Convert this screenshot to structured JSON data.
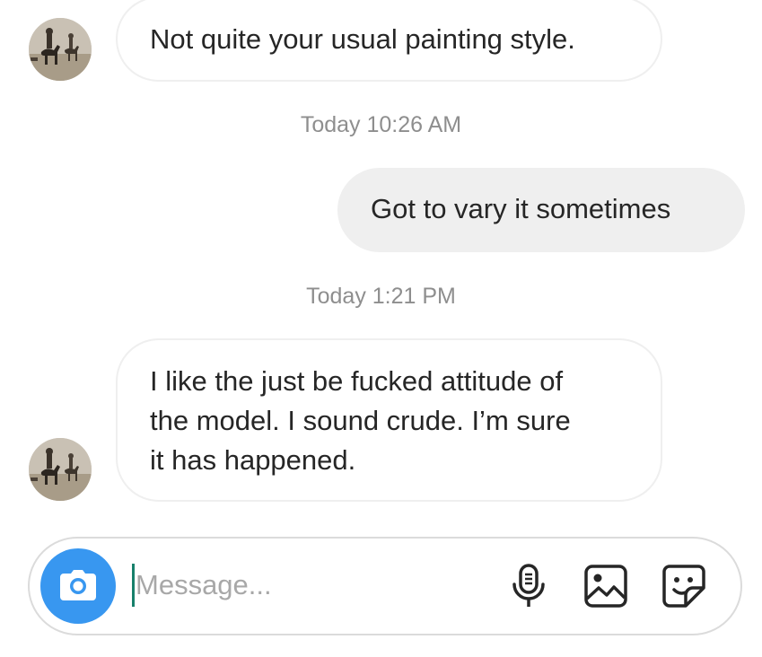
{
  "conversation": {
    "messages": [
      {
        "direction": "incoming",
        "text": "Not quite your usual painting style."
      },
      {
        "direction": "outgoing",
        "text": "Got to vary it sometimes"
      },
      {
        "direction": "incoming",
        "lines": [
          "I like the just be fucked attitude of",
          "the model. I sound crude. I’m sure",
          "it has happened."
        ]
      }
    ],
    "timestamps": [
      "Today 10:26 AM",
      "Today 1:21 PM"
    ]
  },
  "composer": {
    "placeholder": "Message...",
    "value": "",
    "icons": [
      "camera-icon",
      "microphone-icon",
      "gallery-icon",
      "sticker-icon"
    ]
  },
  "colors": {
    "accent": "#3897f0",
    "outgoing_bubble": "#efefef",
    "timestamp_text": "#8e8e8e",
    "caret": "#17806b"
  }
}
